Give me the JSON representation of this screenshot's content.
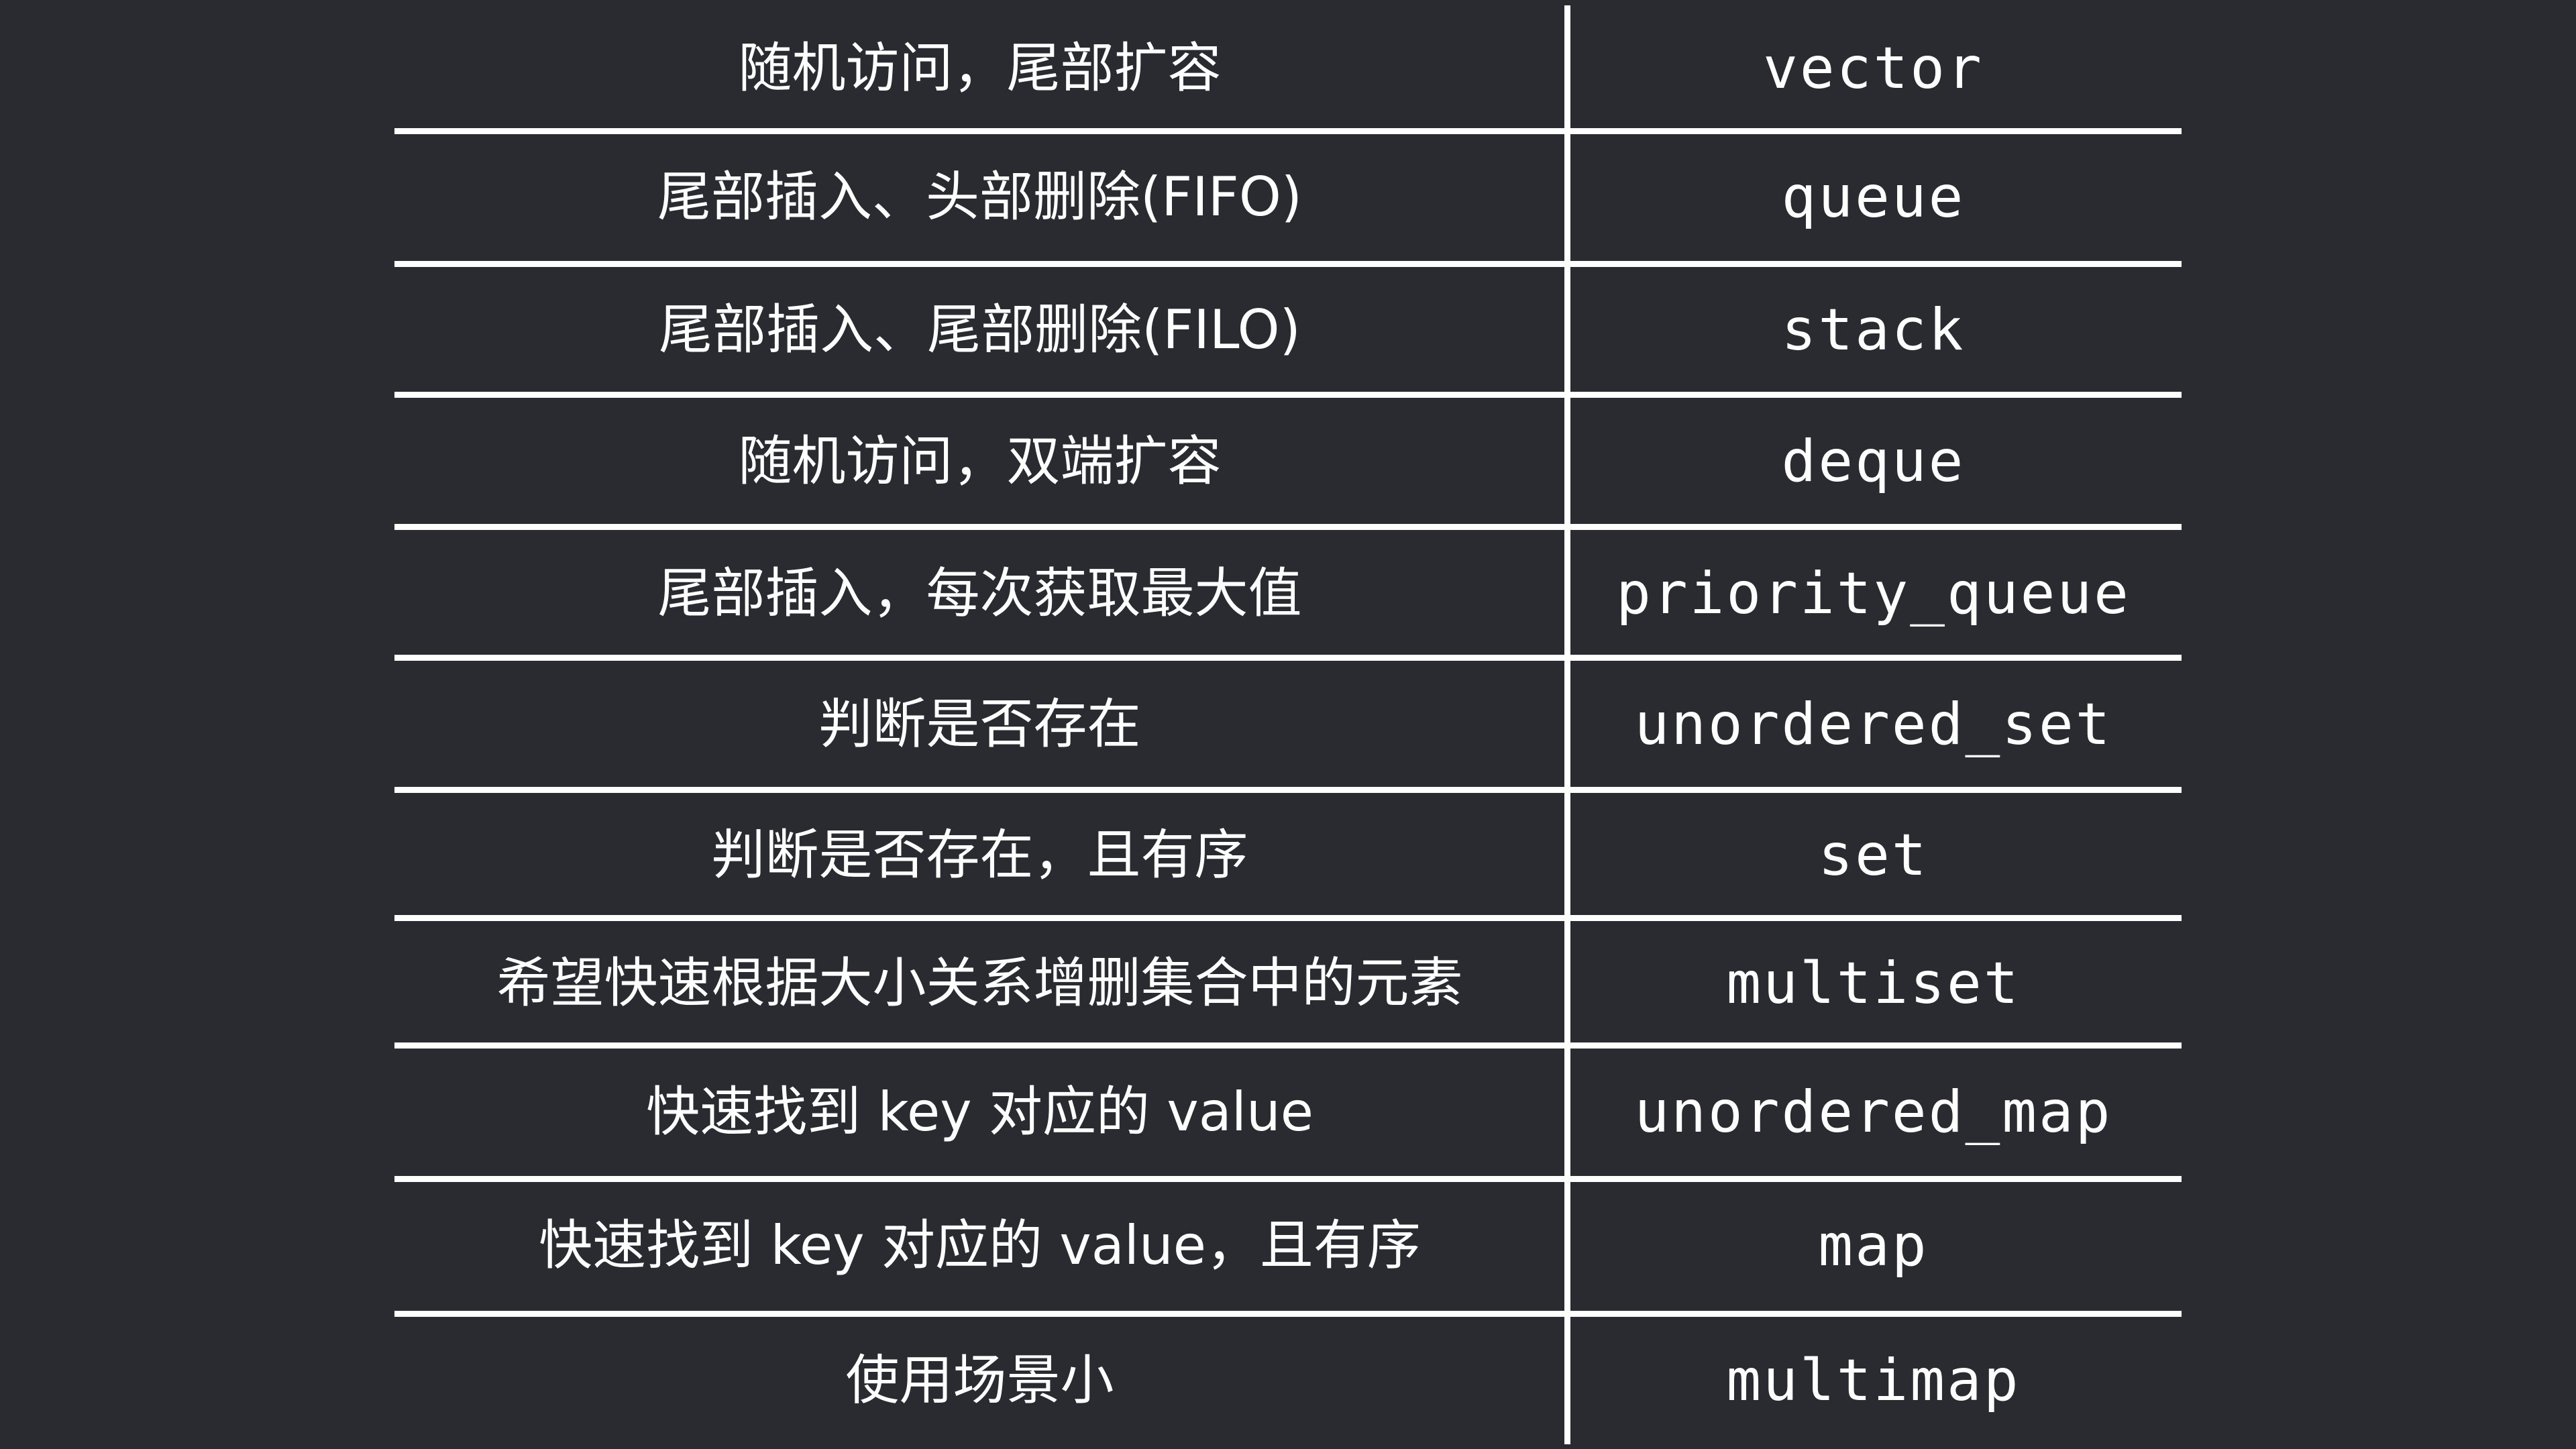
{
  "table": {
    "rows": [
      {
        "scenario": "随机访问，尾部扩容",
        "container": "vector"
      },
      {
        "scenario": "尾部插入、头部删除(FIFO)",
        "container": "queue"
      },
      {
        "scenario": "尾部插入、尾部删除(FILO)",
        "container": "stack"
      },
      {
        "scenario": "随机访问，双端扩容",
        "container": "deque"
      },
      {
        "scenario": "尾部插入，每次获取最大值",
        "container": "priority_queue"
      },
      {
        "scenario": "判断是否存在",
        "container": "unordered_set"
      },
      {
        "scenario": "判断是否存在，且有序",
        "container": "set"
      },
      {
        "scenario": "希望快速根据大小关系增删集合中的元素",
        "container": "multiset"
      },
      {
        "scenario": "快速找到 key 对应的 value",
        "container": "unordered_map"
      },
      {
        "scenario": "快速找到 key 对应的 value，且有序",
        "container": "map"
      },
      {
        "scenario": "使用场景小",
        "container": "multimap"
      }
    ]
  },
  "colors": {
    "background": "#292b31",
    "text": "#ffffff",
    "lines": "#ffffff"
  }
}
